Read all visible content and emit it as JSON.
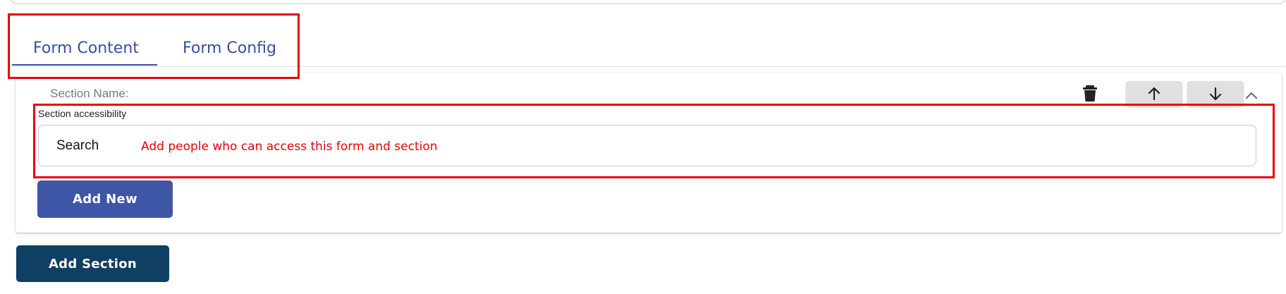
{
  "tabs": [
    {
      "label": "Form Content",
      "active": true
    },
    {
      "label": "Form Config",
      "active": false
    }
  ],
  "section": {
    "name_label": "Section Name:",
    "accessibility_label": "Section accessibility",
    "search_label": "Search",
    "search_placeholder": "Add people who can access this form and section",
    "add_new_label": "Add New"
  },
  "controls": {
    "delete_icon": "trash-icon",
    "move_up_icon": "arrow-up-icon",
    "move_down_icon": "arrow-down-icon",
    "collapse_icon": "chevron-up-icon"
  },
  "add_section_label": "Add Section",
  "colors": {
    "tab_accent": "#3a4ea3",
    "add_new_button": "#3f56a6",
    "add_section_button": "#0f3f63",
    "annotation": "#e8000b"
  }
}
